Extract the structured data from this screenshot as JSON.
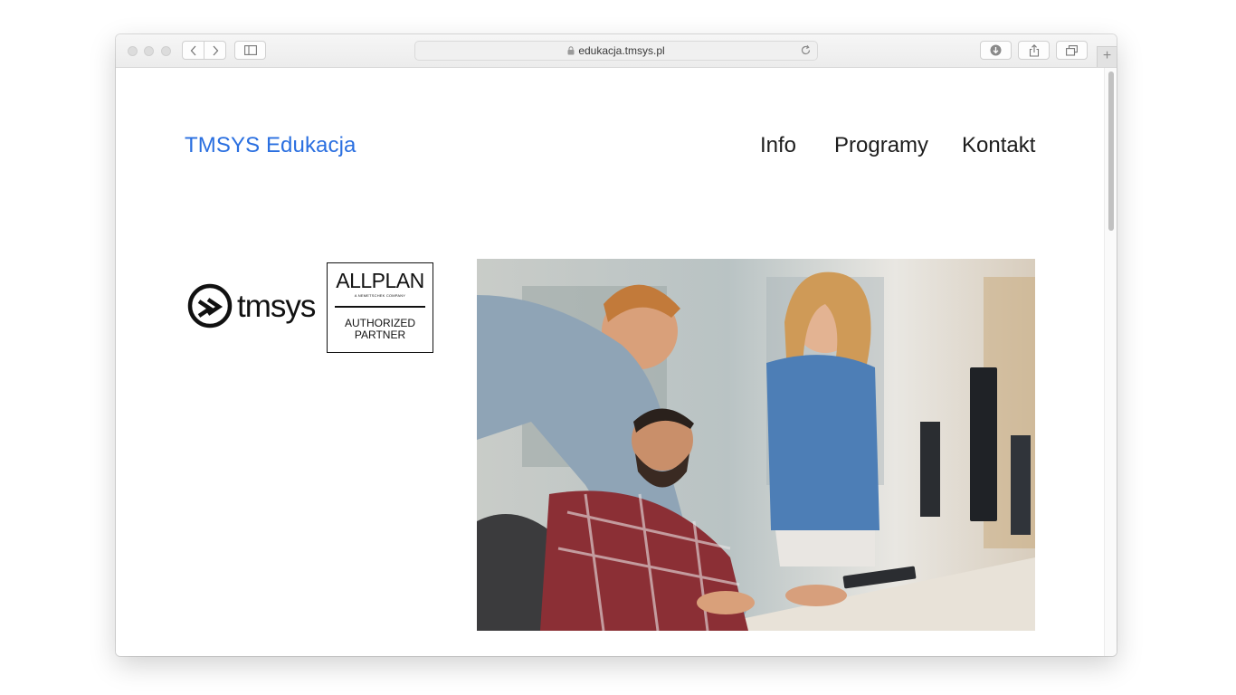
{
  "browser": {
    "url": "edukacja.tmsys.pl",
    "new_tab_label": "+"
  },
  "site": {
    "brand": "TMSYS Edukacja",
    "nav": [
      "Info",
      "Programy",
      "Kontakt"
    ]
  },
  "logos": {
    "tmsys_text": "tmsys",
    "partner_brand": "ALLPLAN",
    "partner_sub": "A NEMETSCHEK COMPANY",
    "partner_line1": "AUTHORIZED",
    "partner_line2": "PARTNER"
  },
  "colors": {
    "brand_link": "#2a6fe0",
    "nav_text": "#1d1d1d"
  },
  "hero_image": {
    "icon": "office-team-photo"
  }
}
